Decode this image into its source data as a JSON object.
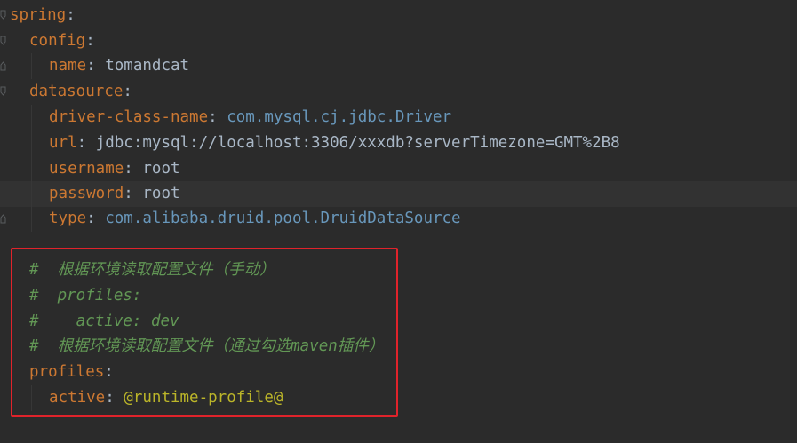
{
  "editor": {
    "lines": [
      {
        "key": "spring",
        "sep": ":",
        "value": ""
      },
      {
        "key": "config",
        "sep": ":",
        "value": ""
      },
      {
        "key": "name",
        "sep": ": ",
        "value": "tomandcat"
      },
      {
        "key": "datasource",
        "sep": ":",
        "value": ""
      },
      {
        "key": "driver-class-name",
        "sep": ": ",
        "value": "com.mysql.cj.jdbc.Driver"
      },
      {
        "key": "url",
        "sep": ": ",
        "value": "jdbc:mysql://localhost:3306/xxxdb?serverTimezone=GMT%2B8"
      },
      {
        "key": "username",
        "sep": ": ",
        "value": "root"
      },
      {
        "key": "password",
        "sep": ": ",
        "value": "root"
      },
      {
        "key": "type",
        "sep": ": ",
        "value": "com.alibaba.druid.pool.DruidDataSource"
      },
      {
        "comment": "#  根据环境读取配置文件（手动）"
      },
      {
        "comment": "#  profiles:"
      },
      {
        "comment": "#    active: dev"
      },
      {
        "comment": "#  根据环境读取配置文件（通过勾选maven插件）"
      },
      {
        "key": "profiles",
        "sep": ":",
        "value": ""
      },
      {
        "key": "active",
        "sep": ": ",
        "value": "@runtime-profile@"
      }
    ]
  },
  "colors": {
    "background": "#2b2b2b",
    "key": "#cc7832",
    "text": "#a9b7c6",
    "comment": "#629755",
    "placeholder": "#bbb529",
    "highlight_border": "#e0232b"
  },
  "icons": {
    "fold": "fold-marker-icon"
  }
}
